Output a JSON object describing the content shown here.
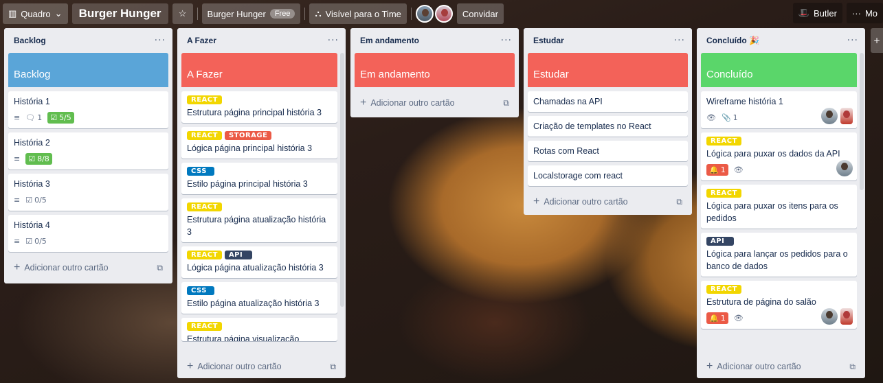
{
  "topbar": {
    "view_label": "Quadro",
    "board_title": "Burger Hunger",
    "workspace_label": "Burger Hunger",
    "workspace_badge": "Free",
    "visibility_label": "Visível para o Time",
    "invite_label": "Convidar",
    "butler_label": "Butler",
    "more_label": "Mo"
  },
  "lists": [
    {
      "title": "Backlog",
      "cover": "Backlog",
      "cover_color": "#5aa5d8",
      "cards": [
        {
          "title": "História 1",
          "comments": "1",
          "checklist": "5/5"
        },
        {
          "title": "História 2",
          "checklist": "8/8"
        },
        {
          "title": "História 3",
          "checklist": "0/5"
        },
        {
          "title": "História 4",
          "checklist": "0/5"
        }
      ],
      "add_label": "Adicionar outro cartão"
    },
    {
      "title": "A Fazer",
      "cover": "A Fazer",
      "cover_color": "#f36259",
      "cards": [
        {
          "labels": [
            "REACT"
          ],
          "title": "Estrutura página principal história 3"
        },
        {
          "labels": [
            "REACT",
            "STORAGE"
          ],
          "title": "Lógica página principal história 3"
        },
        {
          "labels": [
            "CSS"
          ],
          "title": "Estilo página principal história 3"
        },
        {
          "labels": [
            "REACT"
          ],
          "title": "Estrutura página atualização história 3"
        },
        {
          "labels": [
            "REACT",
            "API"
          ],
          "title": "Lógica página atualização história 3"
        },
        {
          "labels": [
            "CSS"
          ],
          "title": "Estilo página atualização história 3"
        },
        {
          "labels": [
            "REACT"
          ],
          "title": "Estrutura página visualização"
        }
      ],
      "add_label": "Adicionar outro cartão"
    },
    {
      "title": "Em andamento",
      "cover": "Em andamento",
      "cover_color": "#f36259",
      "cards": [],
      "add_label": "Adicionar outro cartão"
    },
    {
      "title": "Estudar",
      "cover": "Estudar",
      "cover_color": "#f36259",
      "cards": [
        {
          "title": "Chamadas na API"
        },
        {
          "title": "Criação de templates no React"
        },
        {
          "title": "Rotas com React"
        },
        {
          "title": "Localstorage com react"
        }
      ],
      "add_label": "Adicionar outro cartão"
    },
    {
      "title": "Concluído 🎉",
      "cover": "Concluído",
      "cover_color": "#5ad66a",
      "cards": [
        {
          "title": "Wireframe história 1",
          "attachments": "1"
        },
        {
          "labels": [
            "REACT"
          ],
          "title": "Lógica para puxar os dados da API",
          "alerts": "1"
        },
        {
          "labels": [
            "REACT"
          ],
          "title": "Lógica para puxar os itens para os pedidos"
        },
        {
          "labels": [
            "API"
          ],
          "title": "Lógica para lançar os pedidos para o banco de dados"
        },
        {
          "labels": [
            "REACT"
          ],
          "title": "Estrutura de página do salão",
          "alerts": "1"
        }
      ],
      "add_label": "Adicionar outro cartão"
    }
  ]
}
